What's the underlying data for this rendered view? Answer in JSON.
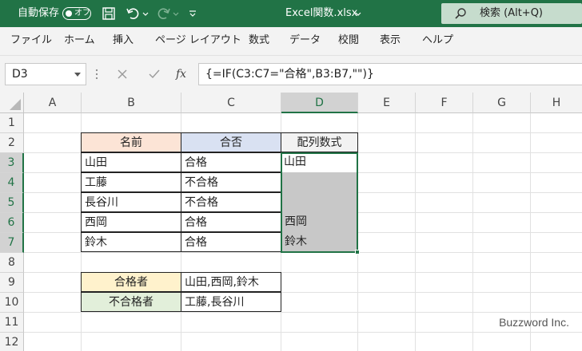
{
  "titlebar": {
    "autosave_label": "自動保存",
    "autosave_state": "オフ",
    "file_title": "Excel関数.xlsx",
    "search_placeholder": "検索 (Alt+Q)"
  },
  "menu": [
    "ファイル",
    "ホーム",
    "挿入",
    "ページ レイアウト",
    "数式",
    "データ",
    "校閲",
    "表示",
    "ヘルプ"
  ],
  "formula_bar": {
    "name_box": "D3",
    "fx_label": "fx",
    "formula": "{=IF(C3:C7=\"合格\",B3:B7,\"\")}"
  },
  "sheet": {
    "columns": [
      "A",
      "B",
      "C",
      "D",
      "E",
      "F",
      "G",
      "H"
    ],
    "active_column": "D",
    "rows": [
      "1",
      "2",
      "3",
      "4",
      "5",
      "6",
      "7",
      "8",
      "9",
      "10",
      "11",
      "12"
    ],
    "active_rows": [
      "3",
      "4",
      "5",
      "6",
      "7"
    ],
    "table": {
      "headers": [
        "名前",
        "合否",
        "配列数式"
      ],
      "header_colors": [
        "#fce4d6",
        "#d9e1f2",
        "#f2f2f2"
      ],
      "rows": [
        [
          "山田",
          "合格",
          "山田"
        ],
        [
          "工藤",
          "不合格",
          ""
        ],
        [
          "長谷川",
          "不合格",
          ""
        ],
        [
          "西岡",
          "合格",
          "西岡"
        ],
        [
          "鈴木",
          "合格",
          "鈴木"
        ]
      ]
    },
    "summary": [
      {
        "label": "合格者",
        "value": "山田,西岡,鈴木",
        "color": "#fff2cc"
      },
      {
        "label": "不合格者",
        "value": "工藤,長谷川",
        "color": "#e2efda"
      }
    ],
    "watermark": "Buzzword Inc."
  },
  "colors": {
    "accent": "#217346",
    "selection_fill": "#c8c8c8"
  }
}
